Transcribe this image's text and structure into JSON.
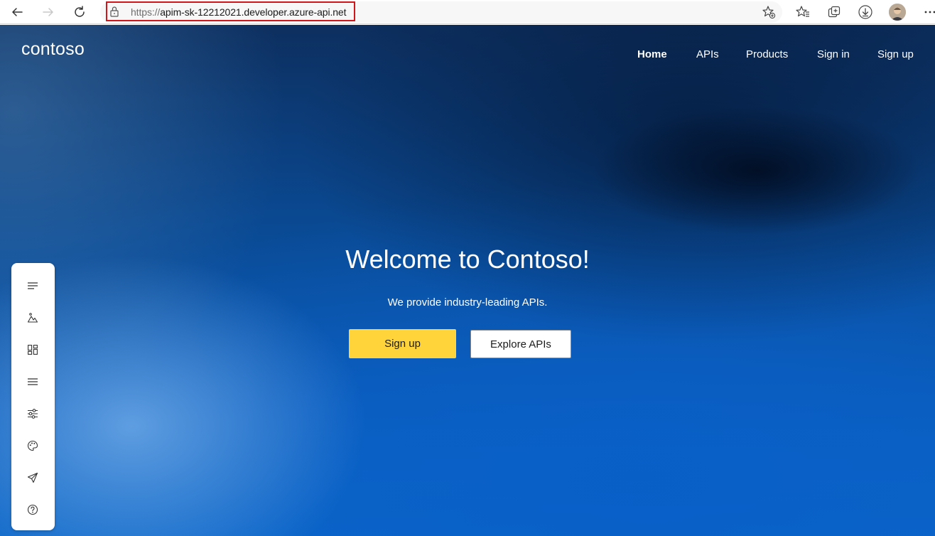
{
  "browser": {
    "url_scheme": "https://",
    "url_host": "apim-sk-12212021.developer.azure-api.net",
    "icons": {
      "back": "back-arrow-icon",
      "forward": "forward-arrow-icon",
      "refresh": "refresh-icon",
      "lock": "lock-icon",
      "favorite_add": "star-add-icon",
      "favorites": "favorites-icon",
      "collections": "collections-icon",
      "downloads": "download-icon",
      "profile": "profile-avatar",
      "more": "more-icon"
    }
  },
  "site": {
    "logo": "contoso",
    "nav": [
      {
        "label": "Home",
        "active": true
      },
      {
        "label": "APIs",
        "active": false
      },
      {
        "label": "Products",
        "active": false
      },
      {
        "label": "Sign in",
        "active": false
      },
      {
        "label": "Sign up",
        "active": false
      }
    ]
  },
  "hero": {
    "title": "Welcome to Contoso!",
    "subtitle": "We provide industry-leading APIs.",
    "primary_button": "Sign up",
    "secondary_button": "Explore APIs"
  },
  "side_toolbar": {
    "icons": [
      "text-lines-icon",
      "media-icon",
      "layout-icon",
      "menu-icon",
      "settings-sliders-icon",
      "palette-icon",
      "publish-icon",
      "help-icon"
    ]
  },
  "colors": {
    "primary_button": "#ffd43a",
    "url_highlight_border": "#d0161b",
    "hero_text": "#ffffff"
  }
}
